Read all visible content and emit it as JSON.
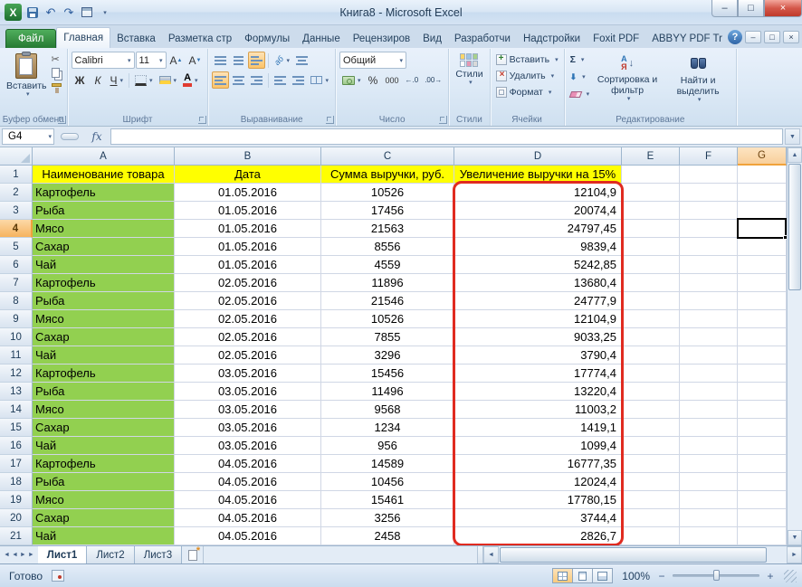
{
  "window": {
    "title": "Книга8  -  Microsoft Excel"
  },
  "tabs": {
    "file": "Файл",
    "active": "Главная",
    "items": [
      "Главная",
      "Вставка",
      "Разметка стр",
      "Формулы",
      "Данные",
      "Рецензиров",
      "Вид",
      "Разработчи",
      "Надстройки",
      "Foxit PDF",
      "ABBYY PDF Tr"
    ]
  },
  "ribbon": {
    "clipboard": {
      "group": "Буфер обмена",
      "paste": "Вставить"
    },
    "font": {
      "group": "Шрифт",
      "name": "Calibri",
      "size": "11",
      "bold": "Ж",
      "italic": "К",
      "underline": "Ч",
      "grow": "А",
      "shrink": "А"
    },
    "alignment": {
      "group": "Выравнивание"
    },
    "number": {
      "group": "Число",
      "format": "Общий",
      "percent": "%",
      "thousands": "000"
    },
    "styles": {
      "group": "Стили",
      "button": "Стили"
    },
    "cells": {
      "group": "Ячейки",
      "insert": "Вставить",
      "delete": "Удалить",
      "format": "Формат"
    },
    "editing": {
      "group": "Редактирование",
      "autosum": "Σ",
      "sort": "Сортировка и фильтр",
      "find": "Найти и выделить"
    }
  },
  "formula_bar": {
    "name_box": "G4",
    "fx": "fx",
    "formula": ""
  },
  "sheet": {
    "active_cell": "G4",
    "col_letters": [
      "A",
      "B",
      "C",
      "D",
      "E",
      "F",
      "G"
    ],
    "header_row": [
      "Наименование товара",
      "Дата",
      "Сумма выручки, руб.",
      "Увеличение выручки на 15%"
    ],
    "rows": [
      [
        "Картофель",
        "01.05.2016",
        "10526",
        "12104,9"
      ],
      [
        "Рыба",
        "01.05.2016",
        "17456",
        "20074,4"
      ],
      [
        "Мясо",
        "01.05.2016",
        "21563",
        "24797,45"
      ],
      [
        "Сахар",
        "01.05.2016",
        "8556",
        "9839,4"
      ],
      [
        "Чай",
        "01.05.2016",
        "4559",
        "5242,85"
      ],
      [
        "Картофель",
        "02.05.2016",
        "11896",
        "13680,4"
      ],
      [
        "Рыба",
        "02.05.2016",
        "21546",
        "24777,9"
      ],
      [
        "Мясо",
        "02.05.2016",
        "10526",
        "12104,9"
      ],
      [
        "Сахар",
        "02.05.2016",
        "7855",
        "9033,25"
      ],
      [
        "Чай",
        "02.05.2016",
        "3296",
        "3790,4"
      ],
      [
        "Картофель",
        "03.05.2016",
        "15456",
        "17774,4"
      ],
      [
        "Рыба",
        "03.05.2016",
        "11496",
        "13220,4"
      ],
      [
        "Мясо",
        "03.05.2016",
        "9568",
        "11003,2"
      ],
      [
        "Сахар",
        "03.05.2016",
        "1234",
        "1419,1"
      ],
      [
        "Чай",
        "03.05.2016",
        "956",
        "1099,4"
      ],
      [
        "Картофель",
        "04.05.2016",
        "14589",
        "16777,35"
      ],
      [
        "Рыба",
        "04.05.2016",
        "10456",
        "12024,4"
      ],
      [
        "Мясо",
        "04.05.2016",
        "15461",
        "17780,15"
      ],
      [
        "Сахар",
        "04.05.2016",
        "3256",
        "3744,4"
      ],
      [
        "Чай",
        "04.05.2016",
        "2458",
        "2826,7"
      ]
    ]
  },
  "sheet_tabs": {
    "active": "Лист1",
    "items": [
      "Лист1",
      "Лист2",
      "Лист3"
    ]
  },
  "status": {
    "ready": "Готово",
    "zoom": "100%"
  },
  "colors": {
    "header_fill": "#ffff00",
    "product_fill": "#92d050",
    "highlight_border": "#e02b20",
    "file_tab_green": "#2e8b3d"
  }
}
